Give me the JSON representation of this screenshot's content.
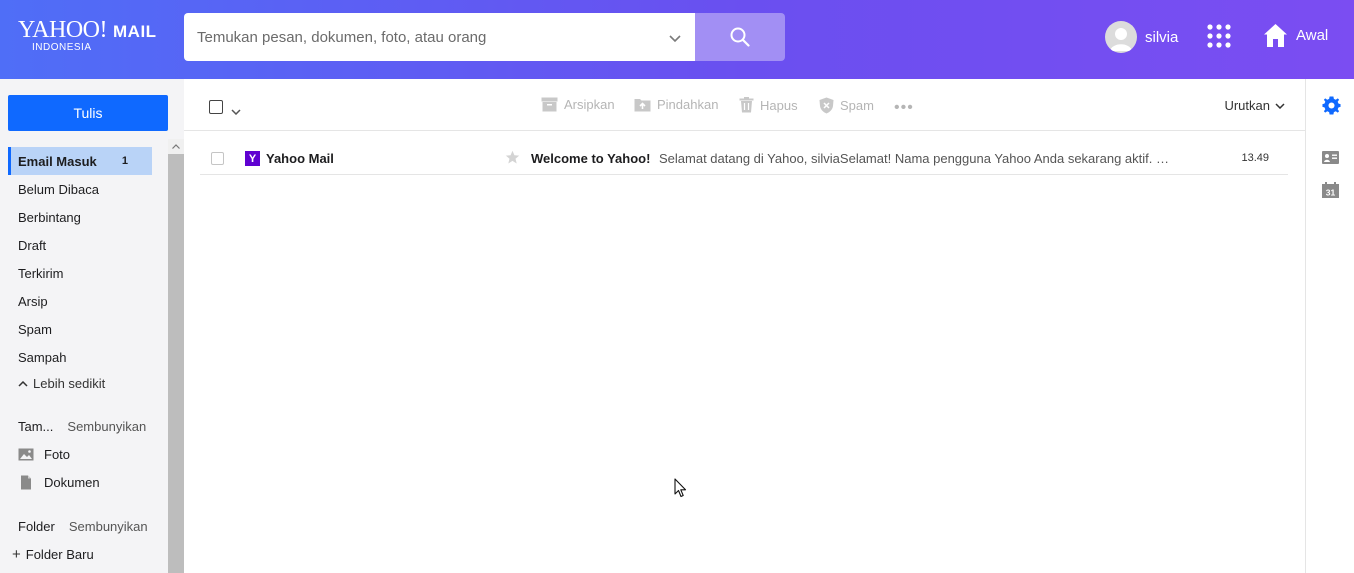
{
  "header": {
    "logo_main": "YAHOO!",
    "logo_mail": "MAIL",
    "logo_region": "INDONESIA",
    "search_placeholder": "Temukan pesan, dokumen, foto, atau orang",
    "user_name": "silvia",
    "home_label": "Awal",
    "gradient_start": "#4f6ef7",
    "gradient_end": "#7b4df2"
  },
  "sidebar": {
    "compose_label": "Tulis",
    "folders": [
      {
        "label": "Email Masuk",
        "count": "1"
      },
      {
        "label": "Belum Dibaca"
      },
      {
        "label": "Berbintang"
      },
      {
        "label": "Draft"
      },
      {
        "label": "Terkirim"
      },
      {
        "label": "Arsip"
      },
      {
        "label": "Spam"
      },
      {
        "label": "Sampah"
      }
    ],
    "less_label": "Lebih sedikit",
    "views_label": "Tam...",
    "views_hide": "Sembunyikan",
    "photos_label": "Foto",
    "docs_label": "Dokumen",
    "folder_label": "Folder",
    "folder_hide": "Sembunyikan",
    "new_folder_label": "Folder Baru"
  },
  "toolbar": {
    "archive": "Arsipkan",
    "move": "Pindahkan",
    "delete": "Hapus",
    "spam": "Spam",
    "more": "•••",
    "sort": "Urutkan"
  },
  "messages": [
    {
      "sender": "Yahoo Mail",
      "sender_icon": "Y",
      "subject": "Welcome to Yahoo!",
      "preview": "Selamat datang di Yahoo, silviaSelamat! Nama pengguna Yahoo Anda sekarang aktif. L...",
      "time": "13.49"
    }
  ],
  "colors": {
    "accent": "#0f69ff",
    "active_folder_bg": "#b9d3f7",
    "yahoo_purple": "#5f01d1"
  }
}
